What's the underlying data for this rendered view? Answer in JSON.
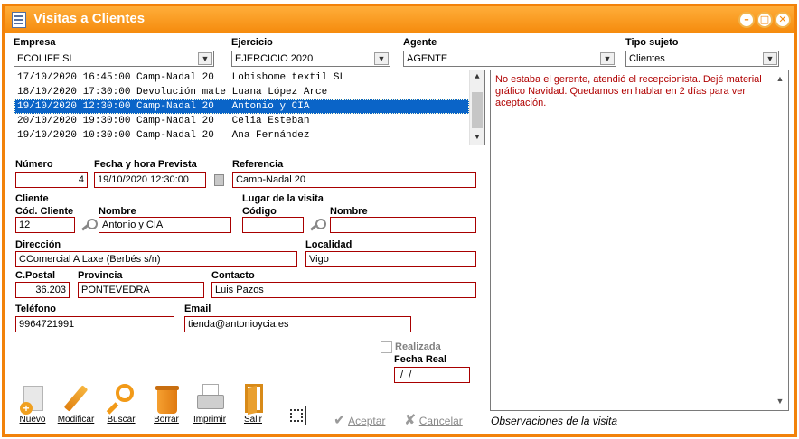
{
  "window": {
    "title": "Visitas a Clientes",
    "accent_color": "#f58a0c",
    "controls": [
      "minimize-icon",
      "maximize-icon",
      "close-icon"
    ]
  },
  "filters": {
    "empresa": {
      "label": "Empresa",
      "value": "ECOLIFE SL"
    },
    "ejercicio": {
      "label": "Ejercicio",
      "value": "EJERCICIO 2020"
    },
    "agente": {
      "label": "Agente",
      "value": "AGENTE"
    },
    "tipo_sujeto": {
      "label": "Tipo sujeto",
      "value": "Clientes"
    }
  },
  "visits": [
    {
      "text": "17/10/2020 16:45:00 Camp-Nadal 20   Lobishome textil SL",
      "selected": false
    },
    {
      "text": "18/10/2020 17:30:00 Devolución mate Luana López Arce",
      "selected": false
    },
    {
      "text": "19/10/2020 12:30:00 Camp-Nadal 20   Antonio y CIA",
      "selected": true
    },
    {
      "text": "20/10/2020 19:30:00 Camp-Nadal 20   Celia Esteban",
      "selected": false
    },
    {
      "text": "19/10/2020 10:30:00 Camp-Nadal 20   Ana Fernández",
      "selected": false
    }
  ],
  "form": {
    "numero": {
      "label": "Número",
      "value": "4"
    },
    "fecha_prevista": {
      "label": "Fecha y hora Prevista",
      "value": "19/10/2020 12:30:00"
    },
    "referencia": {
      "label": "Referencia",
      "value": "Camp-Nadal 20"
    },
    "cliente_section": "Cliente",
    "cod_cliente": {
      "label": "Cód. Cliente",
      "value": "12"
    },
    "nombre_cliente": {
      "label": "Nombre",
      "value": "Antonio y CIA"
    },
    "lugar_section": "Lugar de la visita",
    "lugar_codigo": {
      "label": "Código",
      "value": ""
    },
    "lugar_nombre": {
      "label": "Nombre",
      "value": ""
    },
    "direccion": {
      "label": "Dirección",
      "value": "CComercial A Laxe (Berbés s/n)"
    },
    "localidad": {
      "label": "Localidad",
      "value": "Vigo"
    },
    "cpostal": {
      "label": "C.Postal",
      "value": "36.203"
    },
    "provincia": {
      "label": "Provincia",
      "value": "PONTEVEDRA"
    },
    "contacto": {
      "label": "Contacto",
      "value": "Luis Pazos"
    },
    "telefono": {
      "label": "Teléfono",
      "value": "9964721991"
    },
    "email": {
      "label": "Email",
      "value": "tienda@antonioycia.es"
    },
    "realizada": {
      "label": "Realizada",
      "checked": false
    },
    "fecha_real": {
      "label": "Fecha Real",
      "value": " /  /"
    }
  },
  "notes": {
    "text": "No estaba el gerente, atendió el recepcionista. Dejé material gráfico Navidad. Quedamos en hablar en 2 días para ver aceptación.",
    "label": "Observaciones de la visita"
  },
  "toolbar": {
    "nuevo": "Nuevo",
    "modificar": "Modificar",
    "buscar": "Buscar",
    "borrar": "Borrar",
    "imprimir": "Imprimir",
    "salir": "Salir",
    "aceptar": "Aceptar",
    "cancelar": "Cancelar"
  }
}
